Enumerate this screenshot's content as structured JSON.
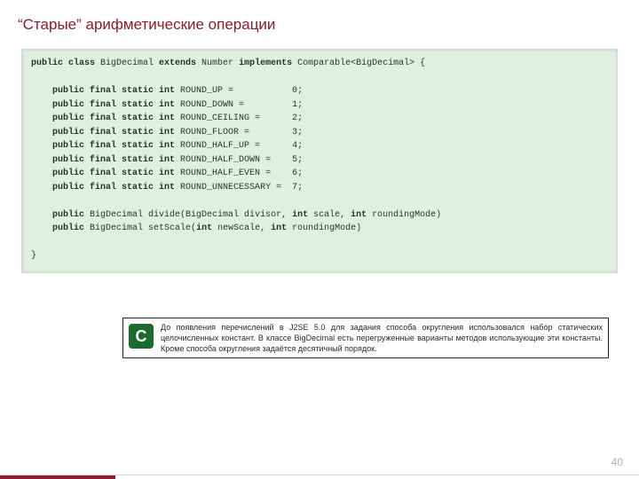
{
  "title": "“Старые” арифметические операции",
  "code": {
    "decl_pre": "public class",
    "cls": " BigDecimal ",
    "decl_mid": "extends",
    "sup": " Number ",
    "decl_imp": "implements",
    "iface": " Comparable<BigDecimal> {",
    "mods": "public final static int",
    "c0n": " ROUND_UP =           0;",
    "c1n": " ROUND_DOWN =         1;",
    "c2n": " ROUND_CEILING =      2;",
    "c3n": " ROUND_FLOOR =        3;",
    "c4n": " ROUND_HALF_UP =      4;",
    "c5n": " ROUND_HALF_DOWN =    5;",
    "c6n": " ROUND_HALF_EVEN =    6;",
    "c7n": " ROUND_UNNECESSARY =  7;",
    "m_kw": "public",
    "m1": " BigDecimal divide(BigDecimal divisor, ",
    "m_int": "int",
    "m1b": " scale, ",
    "m1c": " roundingMode)",
    "m2": " BigDecimal setScale(",
    "m2b": " newScale, ",
    "m2c": " roundingMode)",
    "close": "}"
  },
  "note": {
    "badge": "C",
    "text": "До появления перечислений в J2SE 5.0 для задания способа округления использовался набор статических целочисленных констант. В классе BigDecimal есть перегруженные варианты методов использующие эти константы. Кроме способа округления задаётся десятичный порядок."
  },
  "page": "40"
}
